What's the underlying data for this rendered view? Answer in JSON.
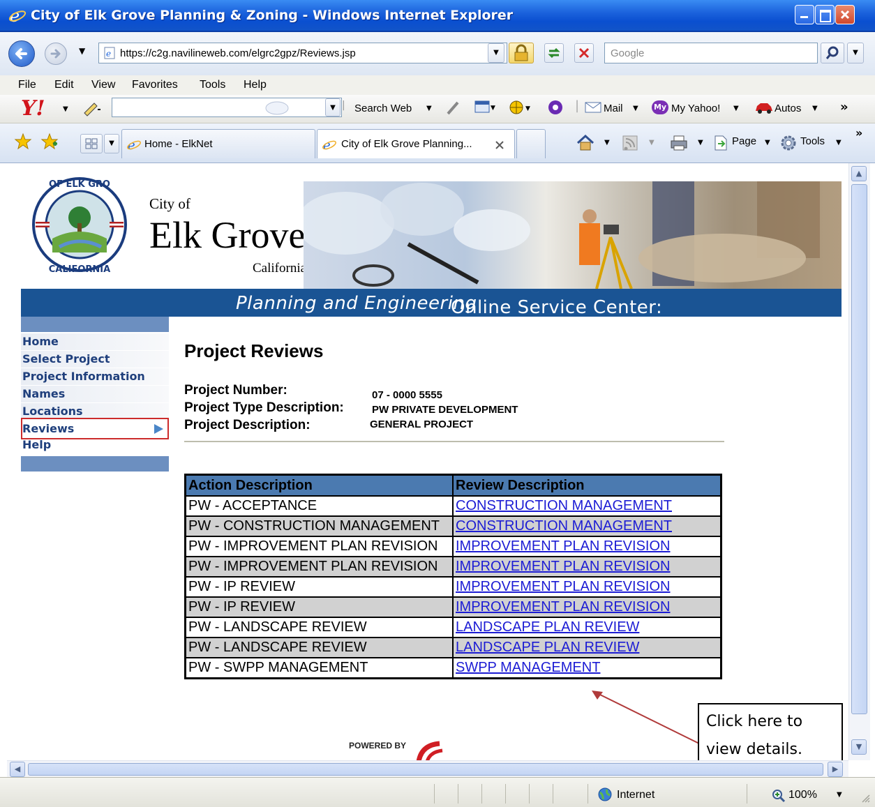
{
  "window": {
    "title": "City of Elk Grove Planning & Zoning - Windows Internet Explorer"
  },
  "address_bar": {
    "url": "https://c2g.navilineweb.com/elgrc2gpz/Reviews.jsp",
    "search_placeholder": "Google"
  },
  "menu": {
    "file": "File",
    "edit": "Edit",
    "view": "View",
    "favorites": "Favorites",
    "tools": "Tools",
    "help": "Help"
  },
  "yahoo_toolbar": {
    "search_web": "Search Web",
    "mail": "Mail",
    "my_yahoo": "My Yahoo!",
    "autos": "Autos",
    "more": "»"
  },
  "tabs": {
    "home": "Home - ElkNet",
    "active": "City of Elk Grove Planning...",
    "page_menu": "Page",
    "tools_menu": "Tools",
    "more": "»"
  },
  "site": {
    "city_of": "City of",
    "city_name": "Elk Grove",
    "state": "California",
    "banner": "Online Service Center: ",
    "banner_italic": "Planning and Engineering"
  },
  "nav": {
    "items": [
      "Home",
      "Select Project",
      "Project Information",
      "Names",
      "Locations",
      "Reviews",
      "Help"
    ],
    "selected": "Reviews"
  },
  "page": {
    "title": "Project Reviews",
    "project_number_label": "Project Number:",
    "project_number": "07 - 0000 5555",
    "project_type_label": "Project Type Description:",
    "project_type": "PW PRIVATE DEVELOPMENT",
    "project_desc_label": "Project Description:",
    "project_desc": "GENERAL PROJECT"
  },
  "table": {
    "headers": [
      "Action Description",
      "Review Description"
    ],
    "rows": [
      [
        "PW - ACCEPTANCE",
        "CONSTRUCTION MANAGEMENT"
      ],
      [
        "PW - CONSTRUCTION MANAGEMENT",
        "CONSTRUCTION MANAGEMENT"
      ],
      [
        "PW - IMPROVEMENT PLAN REVISION",
        "IMPROVEMENT PLAN REVISION"
      ],
      [
        "PW - IMPROVEMENT PLAN REVISION",
        "IMPROVEMENT PLAN REVISION"
      ],
      [
        "PW - IP REVIEW",
        "IMPROVEMENT PLAN REVISION"
      ],
      [
        "PW - IP REVIEW",
        "IMPROVEMENT PLAN REVISION"
      ],
      [
        "PW - LANDSCAPE REVIEW",
        "LANDSCAPE PLAN REVIEW"
      ],
      [
        "PW - LANDSCAPE REVIEW",
        "LANDSCAPE PLAN REVIEW"
      ],
      [
        "PW - SWPP MANAGEMENT",
        "SWPP MANAGEMENT"
      ]
    ]
  },
  "callout": {
    "line1": "Click here to",
    "line2": "view details."
  },
  "footer": {
    "powered_by": "POWERED BY"
  },
  "status": {
    "zone": "Internet",
    "zoom": "100%"
  },
  "colors": {
    "titlebar": "#0a4fd0",
    "banner_blue": "#1a5494",
    "table_header": "#4b7ab0",
    "link": "#1c1cd4",
    "highlight_box": "#cc2b2b"
  }
}
